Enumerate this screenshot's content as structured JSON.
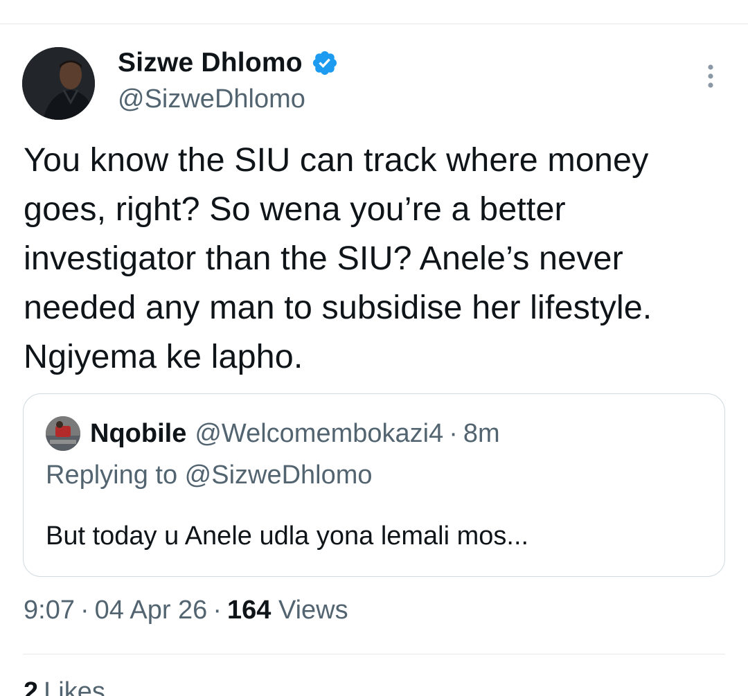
{
  "tweet": {
    "author": {
      "name": "Sizwe Dhlomo",
      "handle": "@SizweDhlomo",
      "verified": true,
      "verified_color": "#1d9bf0"
    },
    "text": "You know the SIU can track where money goes, right? So wena you’re a better investigator than the SIU? Anele’s never needed any man to subsidise her lifestyle. Ngiyema ke lapho.",
    "quoted": {
      "name": "Nqobile",
      "handle": "@Welcomembokazi4",
      "separator": "·",
      "time": "8m",
      "replying_to": "Replying to @SizweDhlomo",
      "text": "But today u Anele udla yona lemali mos..."
    },
    "meta": {
      "time": "9:07",
      "separator": "·",
      "date": "04 Apr 26",
      "views_count": "164",
      "views_label": "Views"
    },
    "likes": {
      "count": "2",
      "label": "Likes"
    }
  },
  "icons": {
    "verified": "verified-badge-icon",
    "more": "more-options-icon"
  }
}
